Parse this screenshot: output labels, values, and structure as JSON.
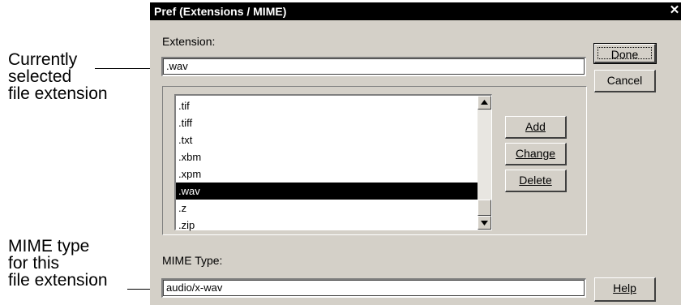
{
  "callouts": {
    "extension_note": "Currently\nselected\nfile extension",
    "mime_note": "MIME type\nfor this\nfile extension"
  },
  "dialog": {
    "title": "Pref (Extensions / MIME)",
    "close_glyph": "✕"
  },
  "extension": {
    "label": "Extension:",
    "value": ".wav"
  },
  "list": {
    "items": [
      ".tif",
      ".tiff",
      ".txt",
      ".xbm",
      ".xpm",
      ".wav",
      ".z",
      ".zip"
    ],
    "selected": ".wav"
  },
  "buttons": {
    "done": "Done",
    "cancel": "Cancel",
    "add": "Add",
    "change": "Change",
    "delete": "Delete",
    "help": "Help"
  },
  "mime": {
    "label": "MIME Type:",
    "value": "audio/x-wav"
  },
  "icons": {
    "scroll_up": "scroll-up-arrow-icon",
    "scroll_down": "scroll-down-arrow-icon",
    "close": "close-icon"
  }
}
